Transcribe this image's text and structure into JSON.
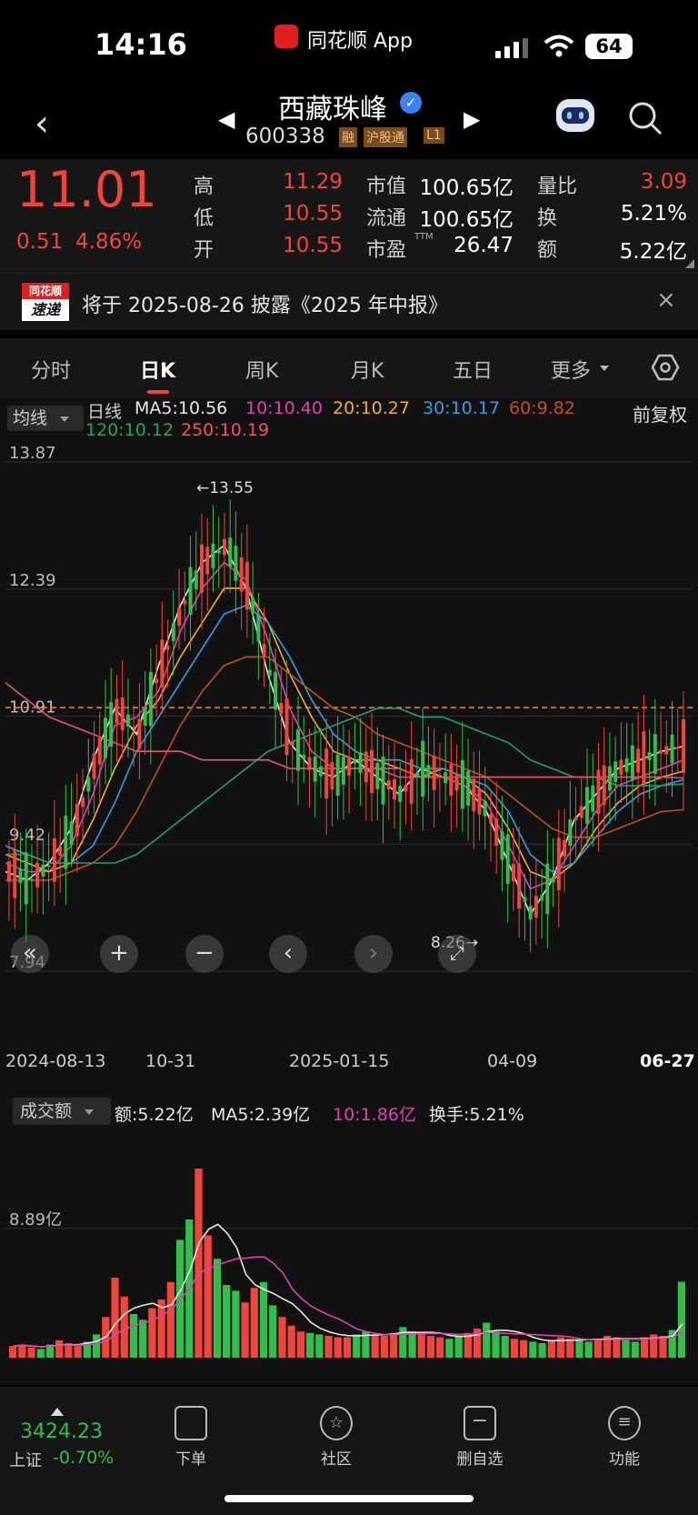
{
  "status_bar": {
    "time": "14:16",
    "app_name": "同花顺 App",
    "battery": "64"
  },
  "header": {
    "stock_name": "西藏珠峰",
    "stock_code": "600338",
    "tags": [
      "融",
      "沪股通",
      "L1"
    ]
  },
  "quote": {
    "price": "11.01",
    "change": "0.51",
    "change_pct": "4.86%",
    "rows": [
      {
        "l1": "高",
        "v1": "11.29",
        "l2": "市值",
        "v2": "100.65亿",
        "l3": "量比",
        "v3": "3.09"
      },
      {
        "l1": "低",
        "v1": "10.55",
        "l2": "流通",
        "v2": "100.65亿",
        "l3": "换",
        "v3": "5.21%"
      },
      {
        "l1": "开",
        "v1": "10.55",
        "l2": "市盈",
        "l2_sup": "TTM",
        "v2": "26.47",
        "l3": "额",
        "v3": "5.22亿"
      }
    ]
  },
  "notice": {
    "logo_top": "同花顺",
    "logo_bottom": "速递",
    "text": "将于 2025-08-26 披露《2025 年中报》"
  },
  "tabs": [
    {
      "label": "分时"
    },
    {
      "label": "日K"
    },
    {
      "label": "周K"
    },
    {
      "label": "月K"
    },
    {
      "label": "五日"
    },
    {
      "label": "更多"
    }
  ],
  "ma_legend": {
    "selector": "均线",
    "period": "日线",
    "items": [
      {
        "text": "MA5:10.56",
        "color": "#e6e6e6"
      },
      {
        "text": "10:10.40",
        "color": "#e040b0"
      },
      {
        "text": "20:10.27",
        "color": "#f0b020"
      },
      {
        "text": "30:10.17",
        "color": "#3a9be0"
      },
      {
        "text": "60:9.82",
        "color": "#c0501a"
      },
      {
        "text": "120:10.12",
        "color": "#20a070"
      },
      {
        "text": "250:10.19",
        "color": "#f05070"
      }
    ],
    "adjust": "前复权"
  },
  "chart_data": {
    "type": "candlestick",
    "y_ticks": [
      "13.87",
      "12.39",
      "10.91",
      "9.42",
      "7.94"
    ],
    "x_ticks": [
      "2024-08-13",
      "10-31",
      "2025-01-15",
      "04-09",
      "06-27"
    ],
    "high_annotation": "←13.55",
    "low_annotation": "8.26→",
    "ylim": [
      7.94,
      13.87
    ],
    "ma_series": [
      {
        "name": "MA5",
        "color": "#e6e6e6",
        "values": [
          9.1,
          9.0,
          9.2,
          9.6,
          10.4,
          11.0,
          10.7,
          11.5,
          12.2,
          12.7,
          12.9,
          12.4,
          11.4,
          10.6,
          10.3,
          10.2,
          10.4,
          10.2,
          10.0,
          10.3,
          10.2,
          10.1,
          9.8,
          9.2,
          8.6,
          9.0,
          9.7,
          10.0,
          10.3,
          10.4,
          10.5,
          10.56
        ]
      },
      {
        "name": "MA10",
        "color": "#e040b0",
        "values": [
          9.2,
          9.1,
          9.1,
          9.4,
          10.0,
          10.8,
          10.9,
          11.2,
          11.9,
          12.4,
          12.7,
          12.5,
          11.8,
          11.0,
          10.5,
          10.3,
          10.3,
          10.3,
          10.2,
          10.2,
          10.2,
          10.1,
          9.9,
          9.4,
          8.9,
          9.0,
          9.4,
          9.8,
          10.1,
          10.2,
          10.3,
          10.4
        ]
      },
      {
        "name": "MA20",
        "color": "#f0b020",
        "values": [
          9.3,
          9.2,
          9.1,
          9.2,
          9.7,
          10.3,
          10.8,
          11.1,
          11.6,
          12.0,
          12.4,
          12.4,
          12.0,
          11.4,
          10.9,
          10.5,
          10.4,
          10.4,
          10.3,
          10.2,
          10.3,
          10.2,
          10.0,
          9.6,
          9.1,
          9.0,
          9.2,
          9.6,
          9.9,
          10.1,
          10.2,
          10.27
        ]
      },
      {
        "name": "MA30",
        "color": "#3a9be0",
        "values": [
          9.4,
          9.3,
          9.2,
          9.2,
          9.4,
          9.9,
          10.5,
          10.9,
          11.3,
          11.7,
          12.1,
          12.2,
          12.0,
          11.6,
          11.1,
          10.7,
          10.5,
          10.4,
          10.4,
          10.3,
          10.3,
          10.2,
          10.1,
          9.8,
          9.3,
          9.1,
          9.2,
          9.5,
          9.8,
          10.0,
          10.1,
          10.17
        ]
      },
      {
        "name": "MA60",
        "color": "#c0501a",
        "values": [
          9.0,
          9.0,
          9.0,
          9.1,
          9.2,
          9.4,
          9.8,
          10.3,
          10.8,
          11.2,
          11.5,
          11.6,
          11.6,
          11.4,
          11.2,
          11.0,
          10.9,
          10.7,
          10.6,
          10.5,
          10.4,
          10.3,
          10.2,
          10.0,
          9.8,
          9.6,
          9.5,
          9.5,
          9.6,
          9.7,
          9.8,
          9.82
        ]
      },
      {
        "name": "MA120",
        "color": "#20a070",
        "values": [
          9.3,
          9.3,
          9.2,
          9.2,
          9.2,
          9.2,
          9.3,
          9.5,
          9.7,
          9.9,
          10.1,
          10.3,
          10.5,
          10.6,
          10.7,
          10.8,
          10.9,
          11.0,
          11.0,
          10.9,
          10.9,
          10.8,
          10.7,
          10.6,
          10.4,
          10.3,
          10.2,
          10.2,
          10.1,
          10.1,
          10.1,
          10.12
        ]
      },
      {
        "name": "MA250",
        "color": "#f05070",
        "values": [
          11.3,
          11.1,
          10.9,
          10.8,
          10.7,
          10.6,
          10.5,
          10.5,
          10.5,
          10.4,
          10.4,
          10.4,
          10.4,
          10.3,
          10.3,
          10.3,
          10.3,
          10.3,
          10.3,
          10.2,
          10.2,
          10.2,
          10.2,
          10.2,
          10.2,
          10.2,
          10.2,
          10.2,
          10.2,
          10.2,
          10.2,
          10.19
        ]
      }
    ],
    "volume": {
      "selector": "成交额",
      "legend": [
        {
          "text": "额:5.22亿",
          "color": "#e6e6e6"
        },
        {
          "text": "MA5:2.39亿",
          "color": "#e6e6e6"
        },
        {
          "text": "10:1.86亿",
          "color": "#e040b0"
        },
        {
          "text": "换手:5.21%",
          "color": "#e6e6e6"
        }
      ],
      "y_tick": "8.89亿",
      "ylim": [
        0,
        15
      ],
      "values": [
        0.8,
        0.9,
        0.7,
        0.6,
        0.9,
        1.2,
        1.0,
        0.8,
        1.1,
        1.6,
        2.8,
        5.5,
        4.2,
        3.0,
        2.6,
        3.4,
        4.0,
        5.2,
        8.1,
        9.5,
        13.0,
        8.4,
        6.8,
        5.0,
        4.6,
        3.8,
        4.8,
        5.2,
        3.6,
        2.8,
        2.2,
        1.8,
        1.7,
        1.6,
        1.5,
        1.4,
        1.4,
        1.6,
        1.8,
        1.6,
        1.5,
        1.7,
        2.1,
        1.8,
        1.6,
        1.5,
        1.4,
        1.3,
        1.5,
        1.7,
        2.0,
        2.4,
        1.8,
        1.5,
        1.3,
        1.2,
        1.1,
        1.0,
        1.2,
        1.4,
        1.3,
        1.2,
        1.1,
        1.3,
        1.5,
        1.4,
        1.2,
        1.1,
        1.4,
        1.6,
        1.5,
        1.9,
        5.22
      ]
    }
  },
  "controls": [
    "«",
    "+",
    "−",
    "‹",
    "›",
    "⤢"
  ],
  "bottom_nav": {
    "index_value": "3424.23",
    "index_name": "上证",
    "index_change": "-0.70%",
    "items": [
      {
        "label": "下单"
      },
      {
        "label": "社区"
      },
      {
        "label": "删自选"
      },
      {
        "label": "功能"
      }
    ]
  }
}
